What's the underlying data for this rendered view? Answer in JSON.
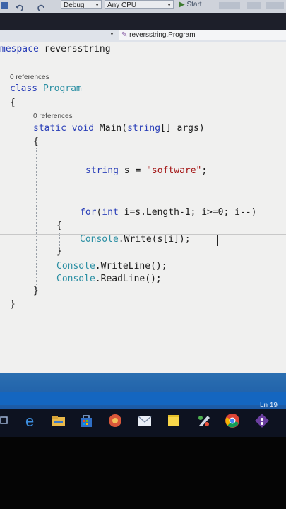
{
  "toolbar": {
    "config": "Debug",
    "platform": "Any CPU",
    "start": "Start",
    "extra_icons": [
      "undo-icon",
      "redo-icon",
      "start-icon",
      "toolbar-icon"
    ]
  },
  "navbar": {
    "class_selector": "reversstring.Program"
  },
  "editor": {
    "lines": {
      "namespace_kw": "mespace",
      "namespace_name": " reversstring",
      "refs_class": "0 references",
      "class_kw": "class",
      "class_name": " Program",
      "brace_open_1": "{",
      "refs_main": "0 references",
      "main_static": "static",
      "main_void": " void",
      "main_rest": " Main(",
      "main_string": "string",
      "main_args": "[] args)",
      "brace_open_2": "{",
      "decl_type": "string",
      "decl_rest": " s = ",
      "decl_value": "\"software\"",
      "decl_end": ";",
      "for_kw": "for",
      "for_open": "(",
      "for_int": "int",
      "for_rest": " i=s.Length-1; i>=0; i--)",
      "brace_open_3": "{",
      "write_class": "Console",
      "write_rest": ".Write(s[i]);",
      "brace_close_3": "}",
      "wl_class": "Console",
      "wl_rest": ".WriteLine();",
      "rl_class": "Console",
      "rl_rest": ".ReadLine();",
      "brace_close_2": "}",
      "brace_close_1": "}"
    }
  },
  "status": {
    "line": "Ln 19"
  },
  "taskbar": {
    "icons": [
      "edge-icon",
      "file-explorer-icon",
      "store-icon",
      "app-icon",
      "mail-icon",
      "sticky-notes-icon",
      "paint-icon",
      "chrome-icon",
      "git-icon"
    ]
  },
  "colors": {
    "keyword": "#2a3fb8",
    "type": "#2b8fa3",
    "string": "#a31515",
    "status_bar": "#1b5aa6"
  }
}
